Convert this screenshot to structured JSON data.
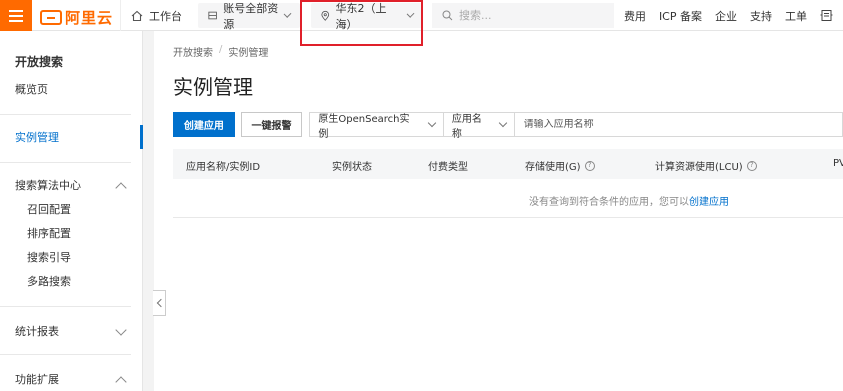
{
  "topbar": {
    "logo_text": "阿里云",
    "workbench": "工作台",
    "account_scope": "账号全部资源",
    "region": "华东2（上海）",
    "search_placeholder": "搜索...",
    "links": [
      "费用",
      "ICP 备案",
      "企业",
      "支持",
      "工单"
    ]
  },
  "sidebar": {
    "title": "开放搜索",
    "overview": "概览页",
    "instance_mgmt": "实例管理",
    "algo_center": "搜索算法中心",
    "algo_sub": [
      "召回配置",
      "排序配置",
      "搜索引导",
      "多路搜索"
    ],
    "stats": "统计报表",
    "extensions": "功能扩展"
  },
  "breadcrumb": [
    "开放搜索",
    "实例管理"
  ],
  "page_title": "实例管理",
  "toolbar": {
    "create_label": "创建应用",
    "alarm_label": "一键报警",
    "type_select": "原生OpenSearch实例",
    "field_select": "应用名称",
    "search_placeholder": "请输入应用名称"
  },
  "table": {
    "headers": [
      "应用名称/实例ID",
      "实例状态",
      "付费类型",
      "存储使用(G)",
      "计算资源使用(LCU)",
      "PV"
    ],
    "empty_text": "没有查询到符合条件的应用，您可以",
    "empty_link": "创建应用"
  },
  "colors": {
    "brand": "#ff6a00",
    "primary": "#0070cc",
    "highlight": "#e0202a"
  }
}
